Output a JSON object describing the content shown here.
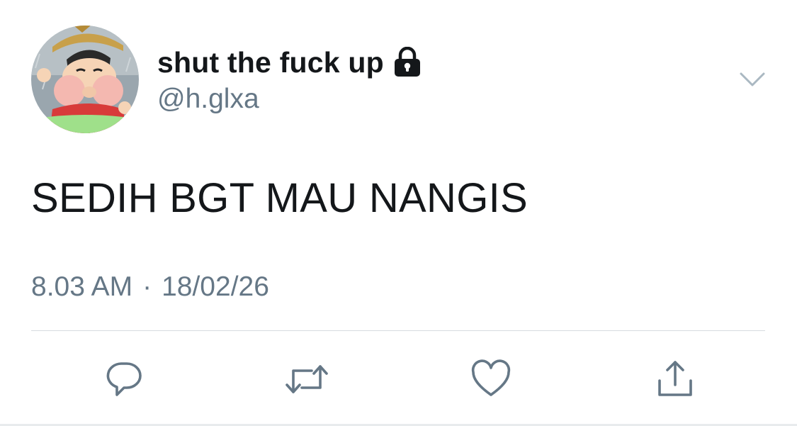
{
  "tweet": {
    "author": {
      "display_name": "shut the fuck up",
      "handle": "@h.glxa",
      "protected_icon": "lock-icon",
      "avatar_icon": "cartoon-avatar"
    },
    "text": "SEDIH BGT MAU NANGIS",
    "time": "8.03 AM",
    "separator": "·",
    "date": "18/02/26"
  },
  "menu": {
    "icon": "chevron-down-icon"
  },
  "actions": [
    {
      "name": "reply",
      "icon": "reply-icon"
    },
    {
      "name": "retweet",
      "icon": "retweet-icon"
    },
    {
      "name": "like",
      "icon": "heart-icon"
    },
    {
      "name": "share",
      "icon": "share-icon"
    }
  ],
  "colors": {
    "text_primary": "#14171a",
    "text_secondary": "#657786",
    "icon_gray": "#657786",
    "divider": "#d6dbdf"
  }
}
